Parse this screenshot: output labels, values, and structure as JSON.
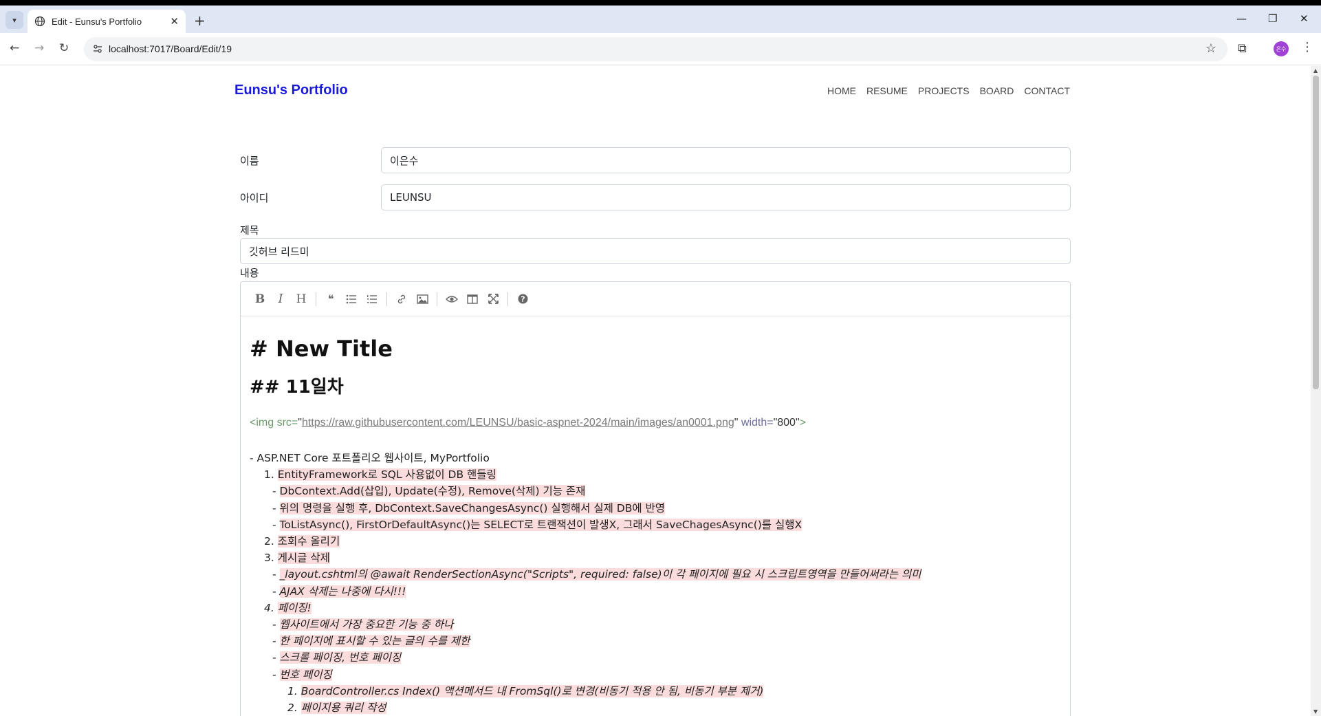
{
  "browser": {
    "tab_title": "Edit - Eunsu's Portfolio",
    "url": "localhost:7017/Board/Edit/19",
    "profile_initials": "은수",
    "icons": [
      "tab-list-icon",
      "globe-icon",
      "close-icon",
      "plus-icon",
      "minimize-icon",
      "restore-icon",
      "window-close-icon",
      "back-icon",
      "forward-icon",
      "reload-icon",
      "site-info-icon",
      "star-icon",
      "extensions-icon",
      "menu-icon"
    ]
  },
  "site": {
    "brand": "Eunsu's Portfolio",
    "nav": [
      "HOME",
      "RESUME",
      "PROJECTS",
      "BOARD",
      "CONTACT"
    ]
  },
  "form": {
    "name_label": "이름",
    "name_value": "이은수",
    "id_label": "아이디",
    "id_value": "LEUNSU",
    "title_label": "제목",
    "title_value": "깃허브 리드미",
    "content_label": "내용"
  },
  "editor": {
    "toolbar": [
      "bold-icon",
      "italic-icon",
      "heading-icon",
      "quote-icon",
      "unordered-list-icon",
      "ordered-list-icon",
      "link-icon",
      "image-icon",
      "preview-icon",
      "side-by-side-icon",
      "fullscreen-icon",
      "help-icon"
    ],
    "h1": "# New Title",
    "h2": "## 11일차",
    "img_tag_open": "<img ",
    "img_src_attr": "src=",
    "img_src_q1": "\"",
    "img_src_url": "https://raw.githubusercontent.com/LEUNSU/basic-aspnet-2024/main/images/an0001.png",
    "img_src_q2": "\"",
    "img_width_attr": " width=",
    "img_width_val": "\"800\"",
    "img_tag_close": ">",
    "lines": [
      {
        "indent": 0,
        "prefix": "- ",
        "text": "ASP.NET Core 포트폴리오 웹사이트, MyPortfolio",
        "hl": false,
        "italic": false
      },
      {
        "indent": 1,
        "prefix": "1. ",
        "text": "EntityFramework로 SQL 사용없이 DB 핸들링",
        "hl": true,
        "italic": false
      },
      {
        "indent": 2,
        "prefix": "- ",
        "text": "DbContext.Add(삽입), Update(수정), Remove(삭제) 기능 존재",
        "hl": true,
        "italic": false
      },
      {
        "indent": 2,
        "prefix": "- ",
        "text": "위의 명령을 실행 후, DbContext.SaveChangesAsync() 실행해서 실제 DB에 반영",
        "hl": true,
        "italic": false
      },
      {
        "indent": 2,
        "prefix": "- ",
        "text": "ToListAsync(), FirstOrDefaultAsync()는 SELECT로 트랜잭션이 발생X, 그래서 SaveChagesAsync()를 실행X",
        "hl": true,
        "italic": false
      },
      {
        "indent": 1,
        "prefix": "2. ",
        "text": "조회수 올리기",
        "hl": true,
        "italic": false
      },
      {
        "indent": 1,
        "prefix": "3. ",
        "text": "게시글 삭제",
        "hl": true,
        "italic": false
      },
      {
        "indent": 2,
        "prefix": "- ",
        "text": "_layout.cshtml의 @await RenderSectionAsync(\"Scripts\", required: false)이 각 페이지에 필요 시 스크립트영역을 만들어써라는 의미",
        "hl": true,
        "italic": true
      },
      {
        "indent": 2,
        "prefix": "- ",
        "text": "AJAX 삭제는 나중에 다시!!!",
        "hl": true,
        "italic": true
      },
      {
        "indent": 1,
        "prefix": "4. ",
        "text": "페이징!",
        "hl": true,
        "italic": true
      },
      {
        "indent": 2,
        "prefix": "- ",
        "text": "웹사이트에서 가장 중요한 기능 중 하나",
        "hl": true,
        "italic": true
      },
      {
        "indent": 2,
        "prefix": "- ",
        "text": "한 페이지에 표시할 수 있는 글의 수를 제한",
        "hl": true,
        "italic": true
      },
      {
        "indent": 2,
        "prefix": "- ",
        "text": "스크롤 페이징, 번호 페이징",
        "hl": true,
        "italic": true
      },
      {
        "indent": 2,
        "prefix": "- ",
        "text": "번호 페이징",
        "hl": true,
        "italic": true
      },
      {
        "indent": 3,
        "prefix": "1. ",
        "text": "BoardController.cs Index() 액션메서드 내 FromSql()로 변경(비동기 적용 안 됨, 비동기 부분 제거)",
        "hl": true,
        "italic": true
      },
      {
        "indent": 3,
        "prefix": "2. ",
        "text": "페이지용 쿼리 작성",
        "hl": true,
        "italic": true
      }
    ]
  }
}
